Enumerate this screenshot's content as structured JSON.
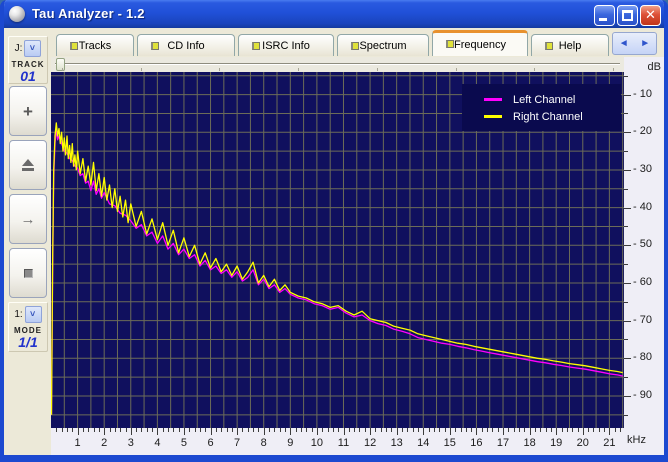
{
  "window": {
    "title": "Tau Analyzer - 1.2",
    "controls": {
      "minimize": "minimize",
      "maximize": "maximize",
      "close": "✕"
    }
  },
  "tabs": [
    {
      "label": "Tracks",
      "active": false
    },
    {
      "label": "CD Info",
      "active": false
    },
    {
      "label": "ISRC Info",
      "active": false
    },
    {
      "label": "Spectrum",
      "active": false
    },
    {
      "label": "Frequency",
      "active": true
    },
    {
      "label": "Help",
      "active": false
    }
  ],
  "tab_scroll": {
    "left": "◄",
    "right": "►"
  },
  "sidebar": {
    "drive_select": {
      "label": "J:"
    },
    "track_caption": "TRACK",
    "track_value": "01",
    "add_button_glyph": "+",
    "arrow_button_glyph": "→",
    "mode_select": {
      "label": "1:"
    },
    "mode_caption": "MODE",
    "mode_value": "1/1"
  },
  "slider": {
    "tick_count": 8,
    "tick_start": 11,
    "tick_step": 78.7,
    "thumb_position": 5
  },
  "chart_data": {
    "type": "line",
    "title": "",
    "xlabel": "kHz",
    "ylabel": "dB",
    "xlim": [
      0,
      21.55
    ],
    "ylim": [
      -98.5,
      -4
    ],
    "x_grid_step": 0.5,
    "y_grid_step": 5,
    "x_minor_step": 0.2,
    "grid": true,
    "legend_position": "top-right",
    "background": "#10105e",
    "grid_color": "#6c6c58",
    "legend_bg": "#0a0a4e",
    "y_ticks": [
      {
        "v": -10,
        "t": "- 10"
      },
      {
        "v": -20,
        "t": "- 20"
      },
      {
        "v": -30,
        "t": "- 30"
      },
      {
        "v": -40,
        "t": "- 40"
      },
      {
        "v": -50,
        "t": "- 50"
      },
      {
        "v": -60,
        "t": "- 60"
      },
      {
        "v": -70,
        "t": "- 70"
      },
      {
        "v": -80,
        "t": "- 80"
      },
      {
        "v": -90,
        "t": "- 90"
      }
    ],
    "x_ticks": [
      {
        "v": 1,
        "t": "1"
      },
      {
        "v": 2,
        "t": "2"
      },
      {
        "v": 3,
        "t": "3"
      },
      {
        "v": 4,
        "t": "4"
      },
      {
        "v": 5,
        "t": "5"
      },
      {
        "v": 6,
        "t": "6"
      },
      {
        "v": 7,
        "t": "7"
      },
      {
        "v": 8,
        "t": "8"
      },
      {
        "v": 9,
        "t": "9"
      },
      {
        "v": 10,
        "t": "10"
      },
      {
        "v": 11,
        "t": "11"
      },
      {
        "v": 12,
        "t": "12"
      },
      {
        "v": 13,
        "t": "13"
      },
      {
        "v": 14,
        "t": "14"
      },
      {
        "v": 15,
        "t": "15"
      },
      {
        "v": 16,
        "t": "16"
      },
      {
        "v": 17,
        "t": "17"
      },
      {
        "v": 18,
        "t": "18"
      },
      {
        "v": 19,
        "t": "19"
      },
      {
        "v": 20,
        "t": "20"
      },
      {
        "v": 21,
        "t": "21"
      }
    ],
    "series": [
      {
        "name": "Left Channel",
        "color": "#ff00ff",
        "points": [
          [
            0.02,
            -95
          ],
          [
            0.06,
            -58
          ],
          [
            0.1,
            -32
          ],
          [
            0.15,
            -23
          ],
          [
            0.2,
            -19
          ],
          [
            0.25,
            -22
          ],
          [
            0.3,
            -21
          ],
          [
            0.4,
            -23
          ],
          [
            0.5,
            -25
          ],
          [
            0.6,
            -25.5
          ],
          [
            0.7,
            -27
          ],
          [
            0.8,
            -27.5
          ],
          [
            0.9,
            -29
          ],
          [
            1.0,
            -29.5
          ],
          [
            1.1,
            -31.5
          ],
          [
            1.2,
            -31
          ],
          [
            1.3,
            -33.5
          ],
          [
            1.4,
            -33
          ],
          [
            1.5,
            -35.5
          ],
          [
            1.6,
            -33
          ],
          [
            1.7,
            -36.5
          ],
          [
            1.8,
            -35
          ],
          [
            1.9,
            -37.5
          ],
          [
            2.0,
            -36
          ],
          [
            2.2,
            -39
          ],
          [
            2.4,
            -39.5
          ],
          [
            2.6,
            -41.5
          ],
          [
            2.8,
            -42
          ],
          [
            3.0,
            -43.5
          ],
          [
            3.2,
            -45.5
          ],
          [
            3.4,
            -44.5
          ],
          [
            3.6,
            -47.5
          ],
          [
            3.8,
            -46.5
          ],
          [
            4.0,
            -49.5
          ],
          [
            4.2,
            -47.5
          ],
          [
            4.4,
            -51
          ],
          [
            4.6,
            -49.5
          ],
          [
            4.8,
            -52.5
          ],
          [
            5.0,
            -51
          ],
          [
            5.2,
            -53.5
          ],
          [
            5.4,
            -52.5
          ],
          [
            5.6,
            -55.5
          ],
          [
            5.8,
            -54
          ],
          [
            6.0,
            -56.5
          ],
          [
            6.2,
            -55.5
          ],
          [
            6.4,
            -57.5
          ],
          [
            6.6,
            -56.5
          ],
          [
            6.8,
            -58.5
          ],
          [
            7.0,
            -57
          ],
          [
            7.2,
            -59.5
          ],
          [
            7.4,
            -58.5
          ],
          [
            7.6,
            -56.5
          ],
          [
            7.8,
            -60.5
          ],
          [
            8.0,
            -59
          ],
          [
            8.2,
            -61.5
          ],
          [
            8.4,
            -60.5
          ],
          [
            8.6,
            -62.5
          ],
          [
            8.8,
            -61.5
          ],
          [
            9.0,
            -63
          ],
          [
            9.3,
            -64
          ],
          [
            9.6,
            -64.5
          ],
          [
            9.9,
            -65.5
          ],
          [
            10.2,
            -66
          ],
          [
            10.5,
            -67
          ],
          [
            10.8,
            -66.5
          ],
          [
            11.1,
            -68
          ],
          [
            11.4,
            -69
          ],
          [
            11.7,
            -68.5
          ],
          [
            12.0,
            -70
          ],
          [
            12.3,
            -70.8
          ],
          [
            12.6,
            -71.3
          ],
          [
            12.9,
            -72.3
          ],
          [
            13.2,
            -72.8
          ],
          [
            13.5,
            -73.5
          ],
          [
            13.8,
            -74.5
          ],
          [
            14.1,
            -75
          ],
          [
            14.4,
            -75.5
          ],
          [
            14.7,
            -76
          ],
          [
            15.0,
            -76.3
          ],
          [
            15.3,
            -76.8
          ],
          [
            15.6,
            -77.2
          ],
          [
            15.9,
            -77.7
          ],
          [
            16.2,
            -78.1
          ],
          [
            16.5,
            -78.5
          ],
          [
            16.8,
            -78.9
          ],
          [
            17.1,
            -79.3
          ],
          [
            17.4,
            -79.7
          ],
          [
            17.7,
            -80.1
          ],
          [
            18.0,
            -80.5
          ],
          [
            18.3,
            -80.9
          ],
          [
            18.6,
            -81.2
          ],
          [
            18.9,
            -81.6
          ],
          [
            19.2,
            -81.9
          ],
          [
            19.5,
            -82.3
          ],
          [
            19.8,
            -82.6
          ],
          [
            20.1,
            -82.9
          ],
          [
            20.4,
            -83.3
          ],
          [
            20.7,
            -83.7
          ],
          [
            21.0,
            -84.1
          ],
          [
            21.3,
            -84.4
          ],
          [
            21.5,
            -84.7
          ]
        ]
      },
      {
        "name": "Right Channel",
        "color": "#ffff00",
        "points": [
          [
            0.02,
            -95
          ],
          [
            0.06,
            -55
          ],
          [
            0.1,
            -30
          ],
          [
            0.15,
            -21
          ],
          [
            0.2,
            -17.5
          ],
          [
            0.25,
            -21
          ],
          [
            0.3,
            -19
          ],
          [
            0.35,
            -23
          ],
          [
            0.4,
            -20
          ],
          [
            0.45,
            -25
          ],
          [
            0.5,
            -21.5
          ],
          [
            0.55,
            -26
          ],
          [
            0.6,
            -21
          ],
          [
            0.65,
            -27
          ],
          [
            0.7,
            -23.5
          ],
          [
            0.75,
            -28
          ],
          [
            0.8,
            -23
          ],
          [
            0.85,
            -29
          ],
          [
            0.9,
            -26
          ],
          [
            0.95,
            -30
          ],
          [
            1.0,
            -25
          ],
          [
            1.1,
            -31
          ],
          [
            1.2,
            -27
          ],
          [
            1.3,
            -33
          ],
          [
            1.4,
            -29
          ],
          [
            1.5,
            -34
          ],
          [
            1.6,
            -28
          ],
          [
            1.7,
            -35.5
          ],
          [
            1.8,
            -31
          ],
          [
            1.9,
            -37
          ],
          [
            2.0,
            -32
          ],
          [
            2.1,
            -38
          ],
          [
            2.2,
            -34
          ],
          [
            2.3,
            -40
          ],
          [
            2.4,
            -35
          ],
          [
            2.5,
            -41
          ],
          [
            2.6,
            -37
          ],
          [
            2.7,
            -42.5
          ],
          [
            2.8,
            -38
          ],
          [
            2.9,
            -44
          ],
          [
            3.0,
            -39
          ],
          [
            3.2,
            -45
          ],
          [
            3.4,
            -41
          ],
          [
            3.6,
            -47
          ],
          [
            3.8,
            -43
          ],
          [
            4.0,
            -48.5
          ],
          [
            4.2,
            -44
          ],
          [
            4.4,
            -50
          ],
          [
            4.6,
            -46
          ],
          [
            4.8,
            -52
          ],
          [
            5.0,
            -48
          ],
          [
            5.2,
            -53
          ],
          [
            5.4,
            -50
          ],
          [
            5.6,
            -55
          ],
          [
            5.8,
            -52
          ],
          [
            6.0,
            -56
          ],
          [
            6.2,
            -53.5
          ],
          [
            6.4,
            -57
          ],
          [
            6.6,
            -55
          ],
          [
            6.8,
            -58
          ],
          [
            7.0,
            -55.5
          ],
          [
            7.2,
            -59
          ],
          [
            7.4,
            -57
          ],
          [
            7.6,
            -54.5
          ],
          [
            7.8,
            -60
          ],
          [
            8.0,
            -58
          ],
          [
            8.2,
            -61
          ],
          [
            8.4,
            -59
          ],
          [
            8.6,
            -62
          ],
          [
            8.8,
            -60.5
          ],
          [
            9.0,
            -62.5
          ],
          [
            9.3,
            -63.5
          ],
          [
            9.6,
            -64
          ],
          [
            9.9,
            -65
          ],
          [
            10.2,
            -65.5
          ],
          [
            10.5,
            -66.5
          ],
          [
            10.8,
            -66
          ],
          [
            11.1,
            -67.5
          ],
          [
            11.4,
            -68.5
          ],
          [
            11.7,
            -67.5
          ],
          [
            12.0,
            -69.5
          ],
          [
            12.3,
            -70
          ],
          [
            12.6,
            -70.5
          ],
          [
            12.9,
            -71.5
          ],
          [
            13.2,
            -72
          ],
          [
            13.5,
            -72.5
          ],
          [
            13.8,
            -73.5
          ],
          [
            14.1,
            -74
          ],
          [
            14.4,
            -74.5
          ],
          [
            14.7,
            -75
          ],
          [
            15.0,
            -75.5
          ],
          [
            15.3,
            -76
          ],
          [
            15.6,
            -76.3
          ],
          [
            15.9,
            -76.8
          ],
          [
            16.2,
            -77.2
          ],
          [
            16.5,
            -77.6
          ],
          [
            16.8,
            -78
          ],
          [
            17.1,
            -78.4
          ],
          [
            17.4,
            -78.8
          ],
          [
            17.7,
            -79.2
          ],
          [
            18.0,
            -79.6
          ],
          [
            18.3,
            -80
          ],
          [
            18.6,
            -80.3
          ],
          [
            18.9,
            -80.7
          ],
          [
            19.2,
            -81
          ],
          [
            19.5,
            -81.4
          ],
          [
            19.8,
            -81.7
          ],
          [
            20.1,
            -82
          ],
          [
            20.4,
            -82.4
          ],
          [
            20.7,
            -82.8
          ],
          [
            21.0,
            -83.2
          ],
          [
            21.3,
            -83.5
          ],
          [
            21.5,
            -83.8
          ]
        ]
      }
    ]
  }
}
